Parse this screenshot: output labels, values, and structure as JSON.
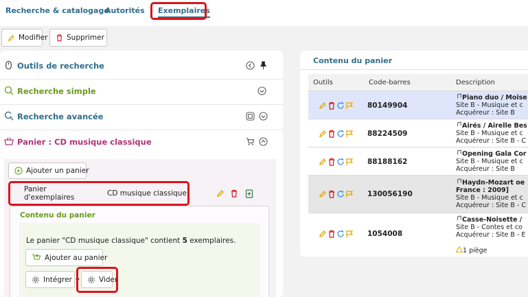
{
  "tabs": [
    {
      "label": "Recherche & catalogage"
    },
    {
      "label": "Autorités"
    },
    {
      "label": "Exemplaires"
    }
  ],
  "toolbar": {
    "modify_label": "Modifier",
    "delete_label": "Supprimer"
  },
  "sections": [
    {
      "title": "Outils de recherche",
      "color": "#2f6e8e"
    },
    {
      "title": "Recherche simple",
      "color": "#6a9a1f"
    },
    {
      "title": "Recherche avancée",
      "color": "#2f6e8e"
    },
    {
      "title": "Panier : CD musique classique",
      "color": "#b0347a"
    }
  ],
  "basket": {
    "add_basket_label": "Ajouter un panier",
    "type_label": "Panier d'exemplaires",
    "name": "CD musique classique",
    "content_title": "Contenu du panier",
    "info_prefix": "Le panier \"CD musique classique\" contient ",
    "info_count": "5",
    "info_suffix": " exemplaires.",
    "add_to_basket_label": "Ajouter au panier",
    "integrate_label": "Intégrer",
    "empty_label": "Vider"
  },
  "right": {
    "title": "Contenu du panier",
    "columns": [
      "Outils",
      "Code-barres",
      "Description"
    ],
    "rows": [
      {
        "barcode": "80149904",
        "lines": [
          "Piano duo / Moise",
          "Site B - Musique et c",
          "Acquéreur : Site B"
        ],
        "highlight": true
      },
      {
        "barcode": "88224509",
        "lines": [
          "Airés / Airelle Bes",
          "Site B - Musique et c",
          "Acquéreur : Site B - C"
        ]
      },
      {
        "barcode": "88188162",
        "lines": [
          "Opening Gala Cor",
          "Site B - Musique et c",
          "Acquéreur : Site B"
        ]
      },
      {
        "barcode": "130056190",
        "lines": [
          "Haydn-Mozart oe",
          "France : 2009]",
          "Site B - Musique et c",
          "Acquéreur : Site B - C"
        ],
        "gray": true
      },
      {
        "barcode": "1054008",
        "lines": [
          "Casse-Noisette /",
          "Site B - Contes et co",
          "Acquéreur : Site B - E"
        ],
        "trap": "1 piège"
      }
    ]
  },
  "colors": {
    "accent": "#2f6e8e",
    "highlight_red": "#d9151b",
    "row_highlight": "#dfe6fb",
    "row_gray": "#e6e6e6"
  }
}
